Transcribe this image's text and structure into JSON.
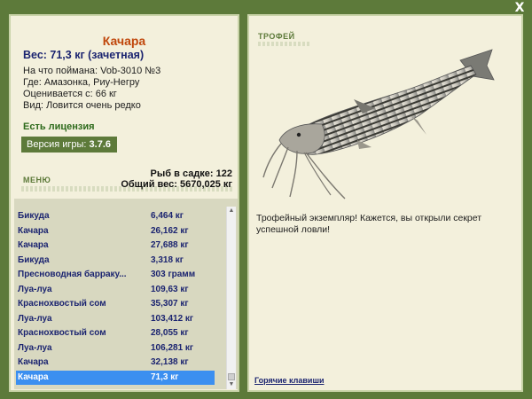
{
  "window": {
    "close_symbol": "X"
  },
  "fish": {
    "name": "Качара",
    "weight_line": "Вес: 71,3 кг (зачетная)",
    "info": [
      "На что поймана: Vob-3010 №3",
      "Где: Амазонка, Риу-Негру",
      "Оценивается с: 66 кг",
      "Вид: Ловится очень редко"
    ]
  },
  "license": "Есть лицензия",
  "version": {
    "label": "Версия игры:",
    "number": "3.7.6"
  },
  "menu_label": "МЕНЮ",
  "stats": {
    "fish_in_net": "Рыб в садке: 122",
    "total_weight": "Общий вес: 5670,025 кг"
  },
  "catch_list": [
    {
      "name": "Бикуда",
      "weight": "6,464 кг"
    },
    {
      "name": "Качара",
      "weight": "26,162 кг"
    },
    {
      "name": "Качара",
      "weight": "27,688 кг"
    },
    {
      "name": "Бикуда",
      "weight": "3,318 кг"
    },
    {
      "name": "Пресноводная барраку...",
      "weight": "303 грамм"
    },
    {
      "name": "Луа-луа",
      "weight": "109,63 кг"
    },
    {
      "name": "Краснохвостый сом",
      "weight": "35,307 кг"
    },
    {
      "name": "Луа-луа",
      "weight": "103,412 кг"
    },
    {
      "name": "Краснохвостый сом",
      "weight": "28,055 кг"
    },
    {
      "name": "Луа-луа",
      "weight": "106,281 кг"
    },
    {
      "name": "Качара",
      "weight": "32,138 кг"
    },
    {
      "name": "Качара",
      "weight": "71,3 кг",
      "selected": true
    }
  ],
  "trophy_label": "ТРОФЕЙ",
  "description": "Трофейный экземпляр! Кажется, вы открыли секрет успешной ловли!",
  "hotkeys_link": "Горячие клавиши",
  "colors": {
    "background": "#5d7a3a",
    "panel": "#f3f0dc",
    "title": "#c0470c",
    "list_text": "#1b2470",
    "selected_row": "#3b8ff0"
  }
}
